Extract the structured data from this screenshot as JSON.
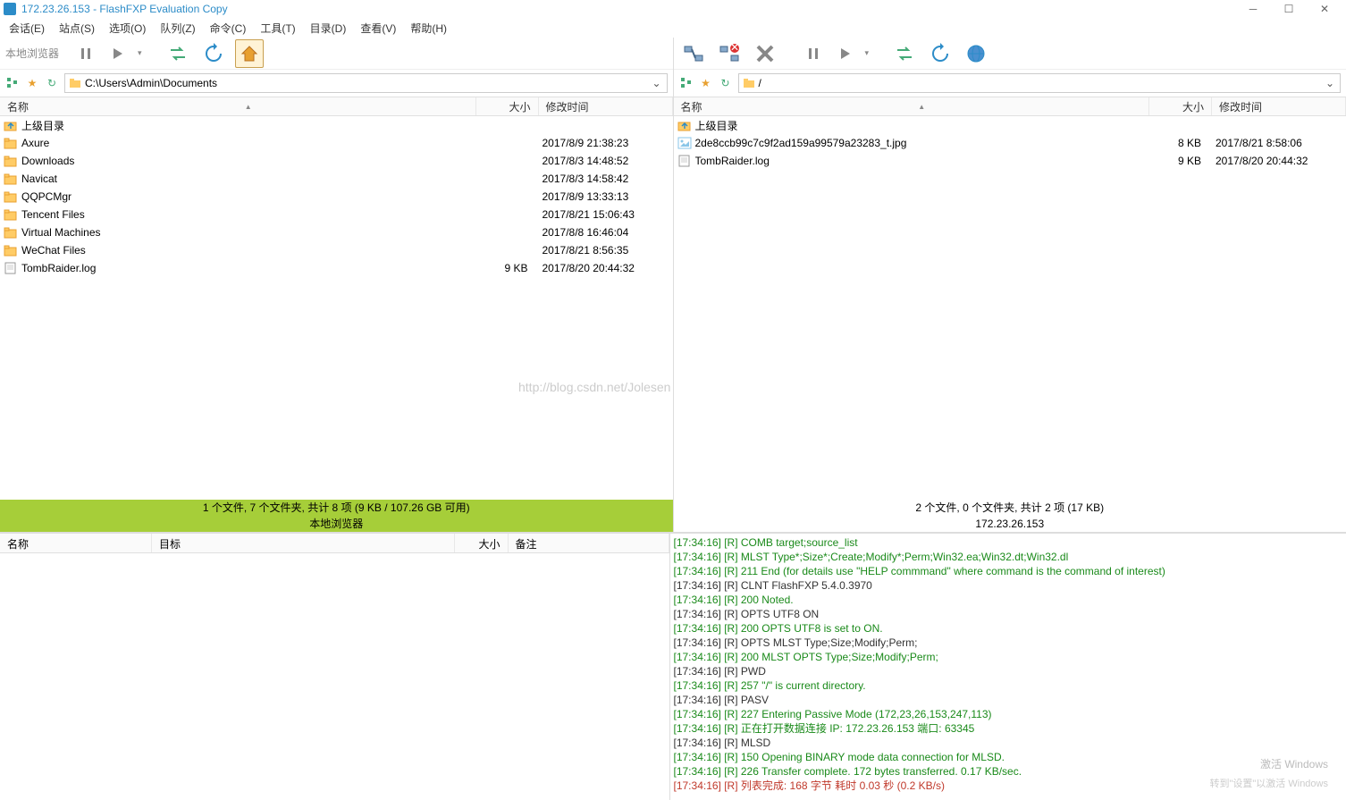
{
  "title": "172.23.26.153 - FlashFXP Evaluation Copy",
  "menus": [
    "会话(E)",
    "站点(S)",
    "选项(O)",
    "队列(Z)",
    "命令(C)",
    "工具(T)",
    "目录(D)",
    "查看(V)",
    "帮助(H)"
  ],
  "left": {
    "label": "本地浏览器",
    "path": "C:\\Users\\Admin\\Documents",
    "cols": {
      "name": "名称",
      "size": "大小",
      "date": "修改时间"
    },
    "updir": "上级目录",
    "rows": [
      {
        "icon": "folder",
        "name": "Axure",
        "size": "",
        "date": "2017/8/9 21:38:23"
      },
      {
        "icon": "folder",
        "name": "Downloads",
        "size": "",
        "date": "2017/8/3 14:48:52"
      },
      {
        "icon": "folder",
        "name": "Navicat",
        "size": "",
        "date": "2017/8/3 14:58:42"
      },
      {
        "icon": "folder",
        "name": "QQPCMgr",
        "size": "",
        "date": "2017/8/9 13:33:13"
      },
      {
        "icon": "folder",
        "name": "Tencent Files",
        "size": "",
        "date": "2017/8/21 15:06:43"
      },
      {
        "icon": "folder",
        "name": "Virtual Machines",
        "size": "",
        "date": "2017/8/8 16:46:04"
      },
      {
        "icon": "folder",
        "name": "WeChat Files",
        "size": "",
        "date": "2017/8/21 8:56:35"
      },
      {
        "icon": "file",
        "name": "TombRaider.log",
        "size": "9 KB",
        "date": "2017/8/20 20:44:32"
      }
    ],
    "status1": "1 个文件, 7 个文件夹, 共计 8 项 (9 KB / 107.26 GB 可用)",
    "status2": "本地浏览器"
  },
  "right": {
    "path": "/",
    "cols": {
      "name": "名称",
      "size": "大小",
      "date": "修改时间"
    },
    "updir": "上级目录",
    "rows": [
      {
        "icon": "image",
        "name": "2de8ccb99c7c9f2ad159a99579a23283_t.jpg",
        "size": "8 KB",
        "date": "2017/8/21 8:58:06"
      },
      {
        "icon": "file",
        "name": "TombRaider.log",
        "size": "9 KB",
        "date": "2017/8/20 20:44:32"
      }
    ],
    "status1": "2 个文件, 0 个文件夹, 共计 2 项 (17 KB)",
    "status2": "172.23.26.153"
  },
  "queue_cols": {
    "name": "名称",
    "target": "目标",
    "size": "大小",
    "note": "备注"
  },
  "log": [
    {
      "c": "g",
      "t": "[17:34:16] [R] COMB target;source_list"
    },
    {
      "c": "g",
      "t": "[17:34:16] [R] MLST Type*;Size*;Create;Modify*;Perm;Win32.ea;Win32.dt;Win32.dl"
    },
    {
      "c": "g",
      "t": "[17:34:16] [R] 211 End (for details use \"HELP commmand\" where command is the command of interest)"
    },
    {
      "c": "b",
      "t": "[17:34:16] [R] CLNT FlashFXP 5.4.0.3970"
    },
    {
      "c": "g",
      "t": "[17:34:16] [R] 200 Noted."
    },
    {
      "c": "b",
      "t": "[17:34:16] [R] OPTS UTF8 ON"
    },
    {
      "c": "g",
      "t": "[17:34:16] [R] 200 OPTS UTF8 is set to ON."
    },
    {
      "c": "b",
      "t": "[17:34:16] [R] OPTS MLST Type;Size;Modify;Perm;"
    },
    {
      "c": "g",
      "t": "[17:34:16] [R] 200 MLST OPTS Type;Size;Modify;Perm;"
    },
    {
      "c": "b",
      "t": "[17:34:16] [R] PWD"
    },
    {
      "c": "g",
      "t": "[17:34:16] [R] 257 \"/\" is current directory."
    },
    {
      "c": "b",
      "t": "[17:34:16] [R] PASV"
    },
    {
      "c": "g",
      "t": "[17:34:16] [R] 227 Entering Passive Mode (172,23,26,153,247,113)"
    },
    {
      "c": "g",
      "t": "[17:34:16] [R] 正在打开数据连接 IP: 172.23.26.153 端口: 63345"
    },
    {
      "c": "b",
      "t": "[17:34:16] [R] MLSD"
    },
    {
      "c": "g",
      "t": "[17:34:16] [R] 150 Opening BINARY mode data connection for MLSD."
    },
    {
      "c": "g",
      "t": "[17:34:16] [R] 226 Transfer complete. 172 bytes transferred. 0.17 KB/sec."
    },
    {
      "c": "r",
      "t": "[17:34:16] [R] 列表完成: 168 字节 耗时 0.03 秒 (0.2 KB/s)"
    }
  ],
  "watermark": "http://blog.csdn.net/Jolesen",
  "wm2_line1": "激活 Windows",
  "wm2_line2": "转到\"设置\"以激活 Windows"
}
